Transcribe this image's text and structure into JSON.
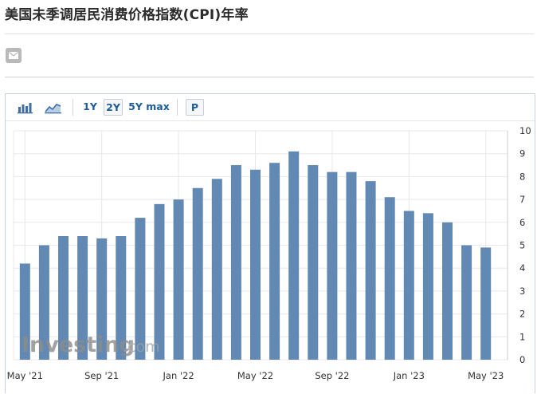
{
  "page": {
    "title": "美国未季调居民消费价格指数(CPI)年率"
  },
  "share": {
    "icon": "mail-icon"
  },
  "toolbar": {
    "bar_chart_icon": "bar-chart-icon",
    "area_chart_icon": "area-chart-icon",
    "range_1y": "1Y",
    "range_2y": "2Y",
    "range_5y": "5Y",
    "range_max": "max",
    "print_label": "P",
    "active_range": "2Y"
  },
  "watermark": {
    "brand": "Investing",
    "suffix": ".com"
  },
  "colors": {
    "bar": "#6189b4",
    "grid": "#e8e8e8",
    "axis_text": "#333333",
    "toolbar_text": "#1e5c9c"
  },
  "chart_data": {
    "type": "bar",
    "categories": [
      "May '21",
      "Jun '21",
      "Jul '21",
      "Aug '21",
      "Sep '21",
      "Oct '21",
      "Nov '21",
      "Dec '21",
      "Jan '22",
      "Feb '22",
      "Mar '22",
      "Apr '22",
      "May '22",
      "Jun '22",
      "Jul '22",
      "Aug '22",
      "Sep '22",
      "Oct '22",
      "Nov '22",
      "Dec '22",
      "Jan '23",
      "Feb '23",
      "Mar '23",
      "Apr '23",
      "May '23"
    ],
    "values": [
      4.2,
      5.0,
      5.4,
      5.4,
      5.3,
      5.4,
      6.2,
      6.8,
      7.0,
      7.5,
      7.9,
      8.5,
      8.3,
      8.6,
      9.1,
      8.5,
      8.2,
      8.2,
      7.8,
      7.1,
      6.5,
      6.4,
      6.0,
      5.0,
      4.9
    ],
    "x_tick_labels": [
      "May '21",
      "Sep '21",
      "Jan '22",
      "May '22",
      "Sep '22",
      "Jan '23",
      "May '23"
    ],
    "y_ticks": [
      0,
      1,
      2,
      3,
      4,
      5,
      6,
      7,
      8,
      9,
      10
    ],
    "ylim": [
      0,
      10
    ],
    "y_axis_side": "right",
    "grid": true,
    "legend": "none"
  }
}
